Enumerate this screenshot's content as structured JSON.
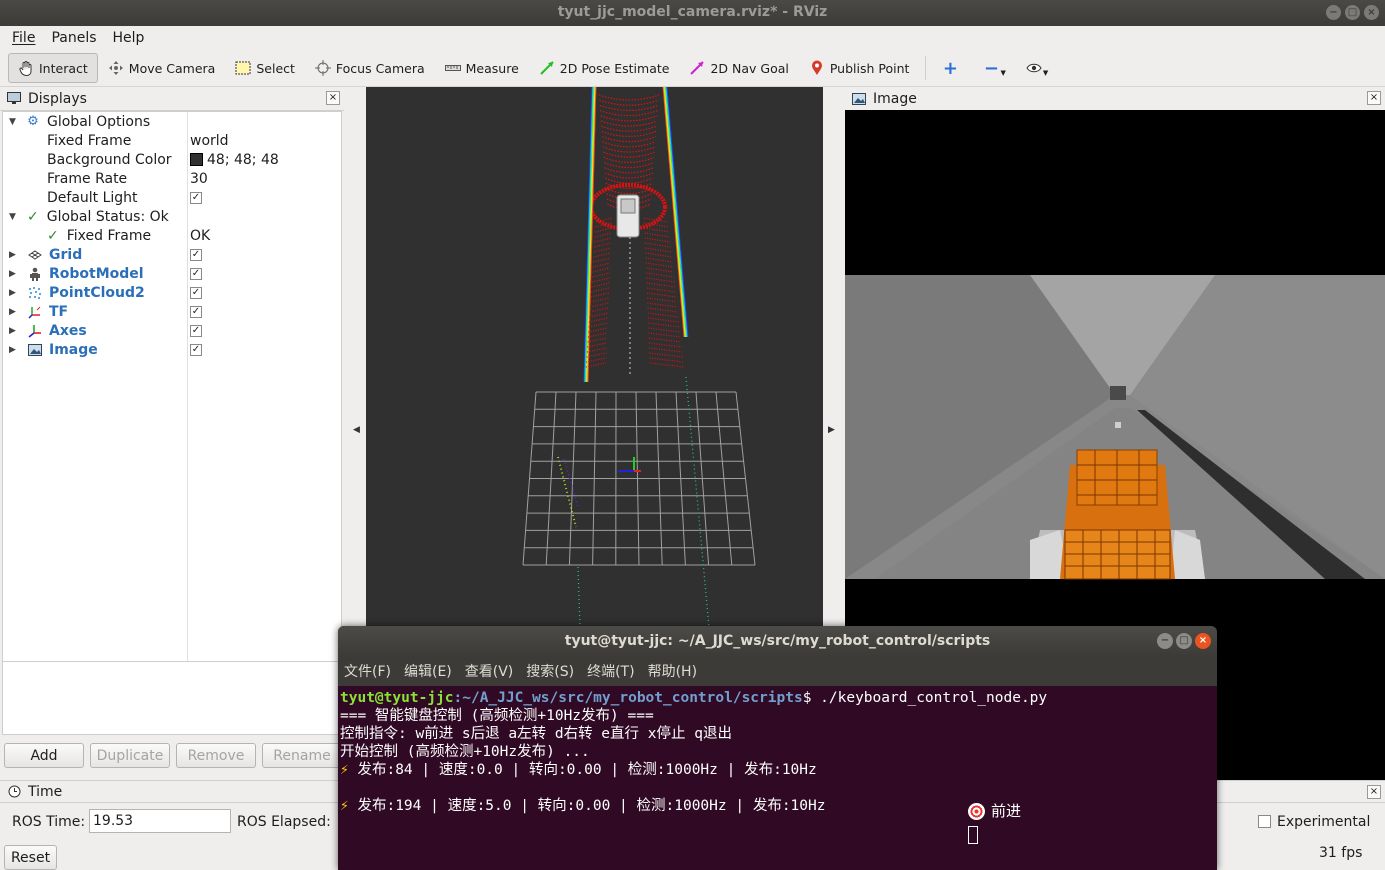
{
  "window": {
    "title": "tyut_jjc_model_camera.rviz* - RViz"
  },
  "menubar": [
    "File",
    "Panels",
    "Help"
  ],
  "toolbar": {
    "tools": [
      {
        "label": "Interact",
        "icon": "hand-icon"
      },
      {
        "label": "Move Camera",
        "icon": "move-camera-icon"
      },
      {
        "label": "Select",
        "icon": "select-icon"
      },
      {
        "label": "Focus Camera",
        "icon": "focus-camera-icon"
      },
      {
        "label": "Measure",
        "icon": "ruler-icon"
      },
      {
        "label": "2D Pose Estimate",
        "icon": "pose-estimate-icon"
      },
      {
        "label": "2D Nav Goal",
        "icon": "nav-goal-icon"
      },
      {
        "label": "Publish Point",
        "icon": "publish-point-icon"
      }
    ],
    "extras": [
      "plus-icon",
      "minus-icon",
      "eye-icon"
    ]
  },
  "displays": {
    "title": "Displays",
    "global_options": "Global Options",
    "fixed_frame_label": "Fixed Frame",
    "fixed_frame_value": "world",
    "background_color_label": "Background Color",
    "background_color_value": "48; 48; 48",
    "background_color_swatch": "#303030",
    "frame_rate_label": "Frame Rate",
    "frame_rate_value": "30",
    "default_light_label": "Default Light",
    "global_status": "Global Status: Ok",
    "status_fixed_frame": "Fixed Frame",
    "status_fixed_frame_value": "OK",
    "plugins": [
      "Grid",
      "RobotModel",
      "PointCloud2",
      "TF",
      "Axes",
      "Image"
    ],
    "buttons": {
      "add": "Add",
      "duplicate": "Duplicate",
      "remove": "Remove",
      "rename": "Rename"
    }
  },
  "image_panel": {
    "title": "Image"
  },
  "time_panel": {
    "title": "Time",
    "ros_time_label": "ROS Time:",
    "ros_time_value": "19.53",
    "ros_elapsed_label": "ROS Elapsed:",
    "reset": "Reset",
    "experimental": "Experimental",
    "fps": "31 fps"
  },
  "terminal": {
    "title": "tyut@tyut-jjc: ~/A_JJC_ws/src/my_robot_control/scripts",
    "menu": [
      "文件(F)",
      "编辑(E)",
      "查看(V)",
      "搜索(S)",
      "终端(T)",
      "帮助(H)"
    ],
    "prompt_user": "tyut@tyut-jjc",
    "prompt_path": ":~/A_JJC_ws/src/my_robot_control/scripts",
    "prompt_cmd": "$ ./keyboard_control_node.py",
    "line1": "=== 智能键盘控制 (高频检测+10Hz发布) ===",
    "line2": "控制指令: w前进 s后退 a左转 d右转 e直行 x停止 q退出",
    "line3": "开始控制 (高频检测+10Hz发布) ...",
    "line4": " 发布:84 | 速度:0.0 | 转向:0.00 | 检测:1000Hz | 发布:10Hz",
    "line5": " 发布:194 | 速度:5.0 | 转向:0.00 | 检测:1000Hz | 发布:10Hz",
    "status": "前进"
  },
  "colors": {
    "accent_ubuntu": "#e95420",
    "terminal_bg": "#300a24",
    "prompt_green": "#8ae234",
    "prompt_blue": "#729fcf",
    "robot_orange": "#e07a10"
  }
}
